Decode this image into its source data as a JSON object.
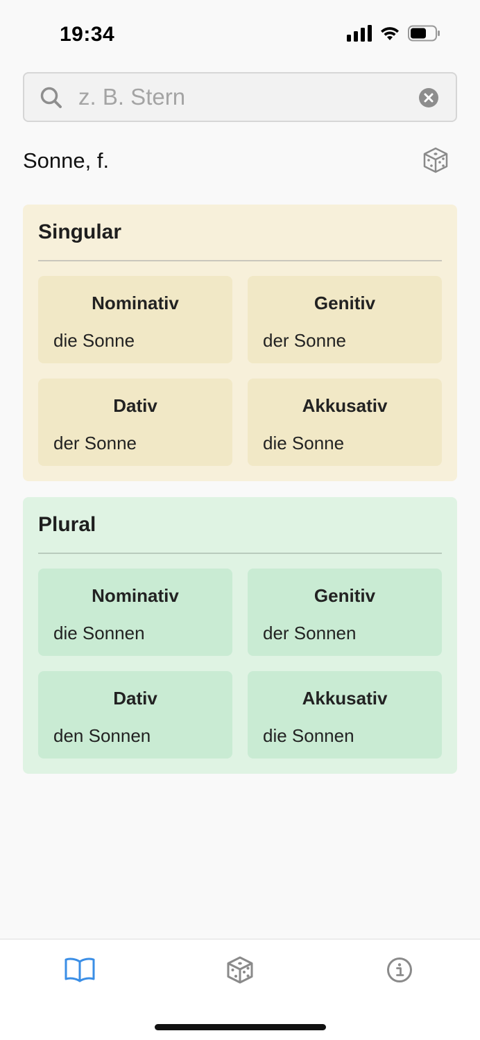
{
  "status_bar": {
    "time": "19:34"
  },
  "search": {
    "placeholder": "z. B. Stern",
    "value": ""
  },
  "word": {
    "title": "Sonne, f."
  },
  "singular": {
    "title": "Singular",
    "cases": [
      {
        "name": "Nominativ",
        "form": "die Sonne"
      },
      {
        "name": "Genitiv",
        "form": "der Sonne"
      },
      {
        "name": "Dativ",
        "form": "der Sonne"
      },
      {
        "name": "Akkusativ",
        "form": "die Sonne"
      }
    ]
  },
  "plural": {
    "title": "Plural",
    "cases": [
      {
        "name": "Nominativ",
        "form": "die Sonnen"
      },
      {
        "name": "Genitiv",
        "form": "der Sonnen"
      },
      {
        "name": "Dativ",
        "form": "den Sonnen"
      },
      {
        "name": "Akkusativ",
        "form": "die Sonnen"
      }
    ]
  },
  "tab_bar": {
    "tabs": [
      {
        "icon": "book-icon",
        "active": true
      },
      {
        "icon": "dice-icon",
        "active": false
      },
      {
        "icon": "info-icon",
        "active": false
      }
    ]
  },
  "colors": {
    "accent": "#3a8ee6",
    "singular_bg": "#f7f0da",
    "singular_card": "#f1e8c6",
    "plural_bg": "#dff3e3",
    "plural_card": "#c9ebd3"
  }
}
